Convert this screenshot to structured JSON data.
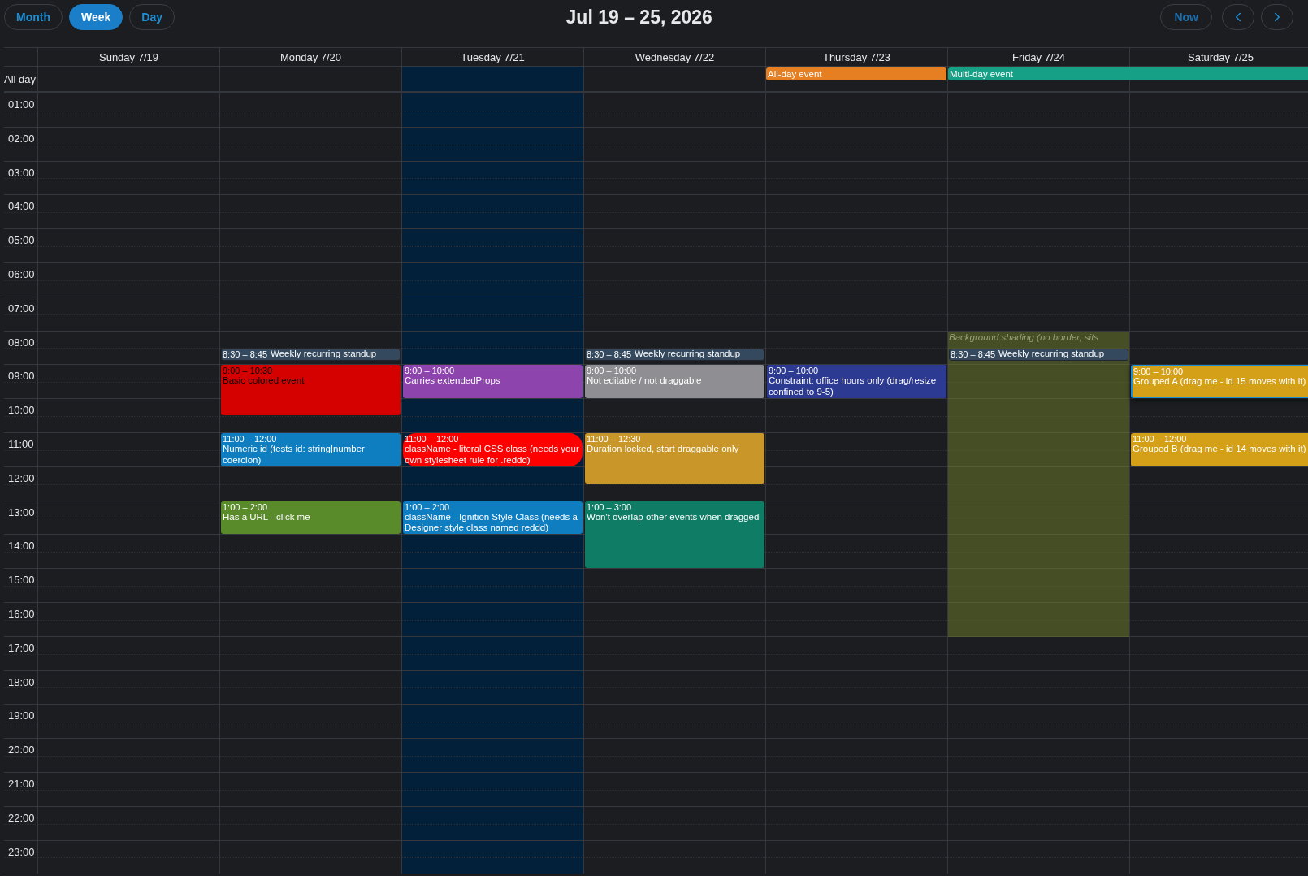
{
  "toolbar": {
    "views": [
      {
        "label": "Month",
        "selected": false
      },
      {
        "label": "Week",
        "selected": true
      },
      {
        "label": "Day",
        "selected": false
      }
    ],
    "title": "Jul 19 – 25, 2026",
    "now_label": "Now"
  },
  "all_day_label": "All day",
  "hours": [
    "01:00",
    "02:00",
    "03:00",
    "04:00",
    "05:00",
    "06:00",
    "07:00",
    "08:00",
    "09:00",
    "10:00",
    "11:00",
    "12:00",
    "13:00",
    "14:00",
    "15:00",
    "16:00",
    "17:00",
    "18:00",
    "19:00",
    "20:00",
    "21:00",
    "22:00",
    "23:00"
  ],
  "days": [
    {
      "label": "Sunday 7/19",
      "today": false
    },
    {
      "label": "Monday 7/20",
      "today": false,
      "events": [
        {
          "kind": "compact",
          "time": "8:30 – 8:45",
          "title": "Weekly recurring standup",
          "color": "#34495e",
          "dark_text": false,
          "selected": false
        },
        {
          "kind": "block",
          "time": "9:00 – 10:30",
          "title": "Basic colored event",
          "color": "#d50000",
          "dark_text": true,
          "selected": false
        },
        {
          "kind": "block",
          "time": "11:00 – 12:00",
          "title": "Numeric id (tests id: string|number coercion)",
          "color": "#0e7ec0",
          "dark_text": false,
          "selected": false
        },
        {
          "kind": "block",
          "time": "1:00 – 2:00",
          "title": "Has a URL - click me",
          "color": "#5a8b2a",
          "dark_text": false,
          "selected": false
        }
      ]
    },
    {
      "label": "Tuesday 7/21",
      "today": true,
      "events": [
        {
          "kind": "block",
          "time": "9:00 – 10:00",
          "title": "Carries extendedProps",
          "color": "#8e44ad",
          "dark_text": false,
          "selected": false
        },
        {
          "kind": "pill",
          "time": "11:00 – 12:00",
          "title": "className - literal CSS class (needs your own stylesheet rule for .reddd)",
          "color": "#ff0000",
          "dark_text": false,
          "selected": false
        },
        {
          "kind": "block",
          "time": "1:00 – 2:00",
          "title": "className - Ignition Style Class (needs a Designer style class named reddd)",
          "color": "#0e7ec0",
          "dark_text": false,
          "selected": false
        }
      ]
    },
    {
      "label": "Wednesday 7/22",
      "today": false,
      "events": [
        {
          "kind": "compact",
          "time": "8:30 – 8:45",
          "title": "Weekly recurring standup",
          "color": "#34495e",
          "dark_text": false,
          "selected": false
        },
        {
          "kind": "block",
          "time": "9:00 – 10:00",
          "title": "Not editable / not draggable",
          "color": "#8e8e93",
          "dark_text": false,
          "selected": false
        },
        {
          "kind": "block",
          "time": "11:00 – 12:30",
          "title": "Duration locked, start draggable only",
          "color": "#c9962a",
          "dark_text": false,
          "selected": false
        },
        {
          "kind": "block",
          "time": "1:00 – 3:00",
          "title": "Won't overlap other events when dragged",
          "color": "#0f7d66",
          "dark_text": false,
          "selected": false
        }
      ]
    },
    {
      "label": "Thursday 7/23",
      "today": false,
      "all_day": [
        {
          "kind": "single",
          "title": "All-day event",
          "color": "#e67e22"
        }
      ],
      "events": [
        {
          "kind": "block",
          "time": "9:00 – 10:00",
          "title": "Constraint: office hours only (drag/resize confined to 9-5)",
          "color": "#2c3a91",
          "dark_text": false,
          "selected": false
        }
      ]
    },
    {
      "label": "Friday 7/24",
      "today": false,
      "all_day": [
        {
          "kind": "multi",
          "title": "Multi-day event",
          "color": "#16a085"
        }
      ],
      "background": {
        "label": "Background shading (no border, sits"
      },
      "events": [
        {
          "kind": "compact",
          "time": "8:30 – 8:45",
          "title": "Weekly recurring standup",
          "color": "#34495e",
          "dark_text": false,
          "selected": false
        }
      ]
    },
    {
      "label": "Saturday 7/25",
      "today": false,
      "events": [
        {
          "kind": "block",
          "time": "9:00 – 10:00",
          "title": "Grouped A (drag me - id 15 moves with it)",
          "color": "#d4a017",
          "dark_text": false,
          "selected": true
        },
        {
          "kind": "block",
          "time": "11:00 – 12:00",
          "title": "Grouped B (drag me - id 14 moves with it)",
          "color": "#d4a017",
          "dark_text": false,
          "selected": false
        }
      ]
    }
  ]
}
